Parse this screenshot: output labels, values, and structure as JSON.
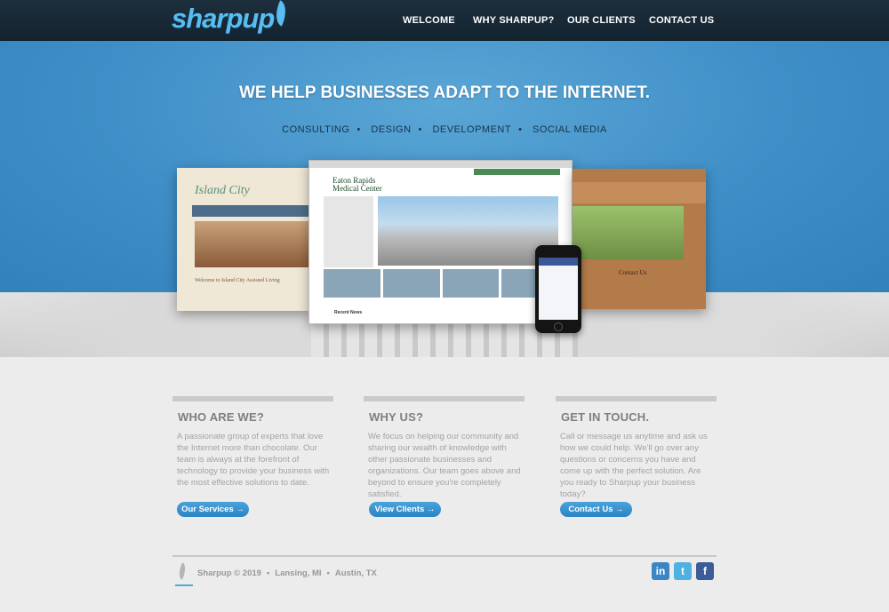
{
  "brand": {
    "logo_text": "sharpup"
  },
  "nav": {
    "items": [
      {
        "label": "WELCOME"
      },
      {
        "label": "WHY SHARPUP?"
      },
      {
        "label": "OUR CLIENTS"
      },
      {
        "label": "CONTACT US"
      }
    ]
  },
  "hero": {
    "title": "WE HELP BUSINESSES ADAPT  TO THE INTERNET.",
    "services": [
      "CONSULTING",
      "DESIGN",
      "DEVELOPMENT",
      "SOCIAL MEDIA"
    ]
  },
  "mockups": {
    "left_brand": "Island City",
    "left_heading": "Welcome to Island City Assisted Living",
    "center_logo_line1": "Eaton Rapids",
    "center_logo_line2": "Medical Center",
    "center_news": "Recent News",
    "right_contact": "Contact Us"
  },
  "columns": [
    {
      "heading": "WHO ARE WE?",
      "text": "A passionate group of experts that love the Internet more than chocolate. Our team is always at the forefront of technology to provide your business with the most effective solutions to date.",
      "button": "Our Services →"
    },
    {
      "heading": "WHY US?",
      "text": "We focus on helping our community and sharing our wealth of knowledge with other passionate businesses and organizations. Our team goes above and beyond to ensure you're completely satisfied.",
      "button": "View Clients →"
    },
    {
      "heading": "GET IN TOUCH.",
      "text": "Call or message us anytime and ask us how we could help. We'll go over any questions or concerns you have and come up with the perfect solution. Are you ready to Sharpup your business today?",
      "button": "Contact Us →"
    }
  ],
  "footer": {
    "copyright": "Sharpup © 2019",
    "location1": "Lansing, MI",
    "location2": "Austin, TX",
    "separator": "•",
    "social": [
      {
        "icon": "linkedin-icon",
        "glyph": "in",
        "color": "#3b86c6"
      },
      {
        "icon": "twitter-icon",
        "glyph": "t",
        "color": "#4fb0e2"
      },
      {
        "icon": "facebook-icon",
        "glyph": "f",
        "color": "#3b5b99"
      }
    ]
  },
  "colors": {
    "accent": "#58bdf0",
    "hero_bg": "#3f8ec7",
    "button": "#2a83c3",
    "nav_bg": "#1a2a38"
  }
}
